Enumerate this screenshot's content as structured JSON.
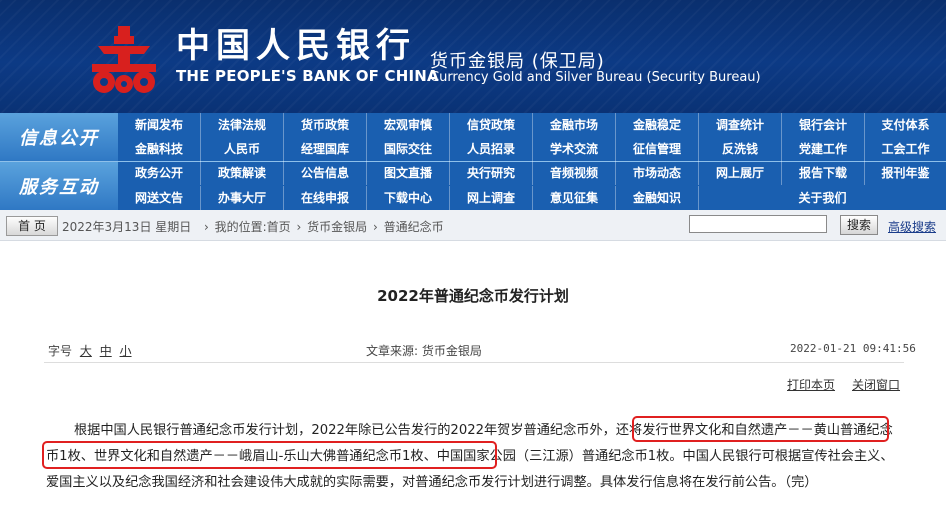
{
  "header": {
    "bank_cn": "中国人民银行",
    "bank_en": "THE PEOPLE'S BANK OF CHINA",
    "bureau_cn": "货币金银局 (保卫局)",
    "bureau_en": "Currency Gold and Silver Bureau (Security Bureau)",
    "logo_icon": "pboc-logo-icon",
    "logo_color": "#d8201e"
  },
  "nav": {
    "section1": "信息公开",
    "section2": "服务互动",
    "row1": [
      "新闻发布",
      "法律法规",
      "货币政策",
      "宏观审慎",
      "信贷政策",
      "金融市场",
      "金融稳定",
      "调查统计",
      "银行会计",
      "支付体系"
    ],
    "row2": [
      "金融科技",
      "人民币",
      "经理国库",
      "国际交往",
      "人员招录",
      "学术交流",
      "征信管理",
      "反洗钱",
      "党建工作",
      "工会工作"
    ],
    "row3": [
      "政务公开",
      "政策解读",
      "公告信息",
      "图文直播",
      "央行研究",
      "音频视频",
      "市场动态",
      "网上展厅",
      "报告下载",
      "报刊年鉴"
    ],
    "row4": [
      "网送文告",
      "办事大厅",
      "在线申报",
      "下载中心",
      "网上调查",
      "意见征集",
      "金融知识",
      "关于我们"
    ],
    "bg_color": "#1a5fb0"
  },
  "breadcrumb": {
    "home_label": "首 页",
    "date": "2022年3月13日 星期日",
    "path": [
      "我的位置:首页",
      "货币金银局",
      "普通纪念币"
    ],
    "separator": "›",
    "search_placeholder": "",
    "search_label": "搜索",
    "advanced_search": "高级搜索"
  },
  "article": {
    "title": "2022年普通纪念币发行计划",
    "font_size_label": "字号",
    "font_sizes": [
      "大",
      "中",
      "小"
    ],
    "source": "文章来源: 货币金银局",
    "datetime": "2022-01-21  09:41:56",
    "print_label": "打印本页",
    "close_label": "关闭窗口",
    "body_part1": "根据中国人民银行普通纪念币发行计划，2022年除已公告发行的2022年贺岁普通纪念币外，",
    "body_part2": "还将发行世界文化和自然遗产－－黄山普通纪念币1枚、世界文化和自然遗产－－峨眉山-乐山大佛普通纪念币1枚",
    "body_part3": "、中国国家公园（三江源）普通纪念币1枚。中国人民银行可根据宣传社会主义、爱国主义以及纪念我国经济和社会建设伟大成就的实际需要，对普通纪念币发行计划进行调整。具体发行信息将在发行前公告。（完）",
    "highlight_color": "#e02020"
  }
}
